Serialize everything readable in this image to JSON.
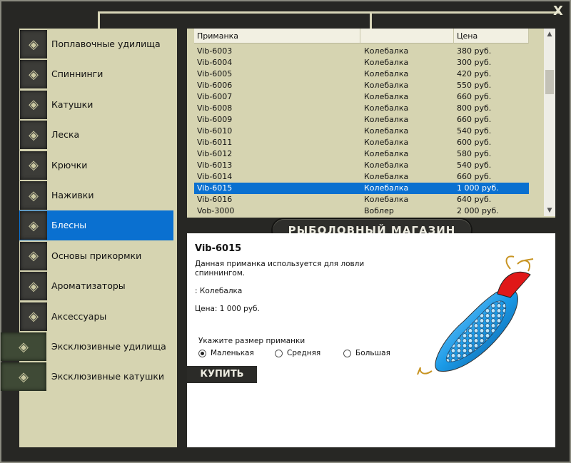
{
  "window": {
    "close_label": "X"
  },
  "categories": [
    {
      "label": "Поплавочные удилища",
      "icon": "rod-icon"
    },
    {
      "label": "Спиннинги",
      "icon": "spinning-rod-icon"
    },
    {
      "label": "Катушки",
      "icon": "reel-icon"
    },
    {
      "label": "Леска",
      "icon": "line-spool-icon"
    },
    {
      "label": "Крючки",
      "icon": "hook-icon"
    },
    {
      "label": "Наживки",
      "icon": "bait-icon"
    },
    {
      "label": "Блесны",
      "icon": "spoon-lure-icon",
      "selected": true
    },
    {
      "label": "Основы прикормки",
      "icon": "groundbait-icon"
    },
    {
      "label": "Ароматизаторы",
      "icon": "flavor-bottle-icon"
    },
    {
      "label": "Аксессуары",
      "icon": "accessories-icon"
    },
    {
      "label": "Эксклюзивные удилища",
      "icon": "exclusive-rod-icon"
    },
    {
      "label": "Эксклюзивные катушки",
      "icon": "exclusive-reel-icon"
    }
  ],
  "table": {
    "columns": [
      "Приманка",
      "",
      "Цена"
    ],
    "rows": [
      [
        "Vib-6003",
        "Колебалка",
        "380 руб."
      ],
      [
        "Vib-6004",
        "Колебалка",
        "300 руб."
      ],
      [
        "Vib-6005",
        "Колебалка",
        "420 руб."
      ],
      [
        "Vib-6006",
        "Колебалка",
        "550 руб."
      ],
      [
        "Vib-6007",
        "Колебалка",
        "660 руб."
      ],
      [
        "Vib-6008",
        "Колебалка",
        "800 руб."
      ],
      [
        "Vib-6009",
        "Колебалка",
        "660 руб."
      ],
      [
        "Vib-6010",
        "Колебалка",
        "540 руб."
      ],
      [
        "Vib-6011",
        "Колебалка",
        "600 руб."
      ],
      [
        "Vib-6012",
        "Колебалка",
        "580 руб."
      ],
      [
        "Vib-6013",
        "Колебалка",
        "540 руб."
      ],
      [
        "Vib-6014",
        "Колебалка",
        "660 руб."
      ],
      [
        "Vib-6015",
        "Колебалка",
        "1 000 руб."
      ],
      [
        "Vib-6016",
        "Колебалка",
        "640 руб."
      ],
      [
        "Vob-3000",
        "Воблер",
        "2 000 руб."
      ]
    ],
    "selected_index": 12
  },
  "banner": "РЫБОЛОВНЫЙ МАГАЗИН",
  "product": {
    "name": "Vib-6015",
    "description": "Данная приманка используется для ловли спиннингом.",
    "type_line": ": Колебалка",
    "price_line": "Цена: 1 000 руб.",
    "size_label": "Укажите размер приманки",
    "sizes": [
      "Маленькая",
      "Средняя",
      "Большая"
    ],
    "selected_size": 0,
    "buy_label": "КУПИТЬ"
  },
  "colors": {
    "selection": "#0a70d0",
    "panel": "#d6d4b1",
    "frame": "#272724"
  }
}
